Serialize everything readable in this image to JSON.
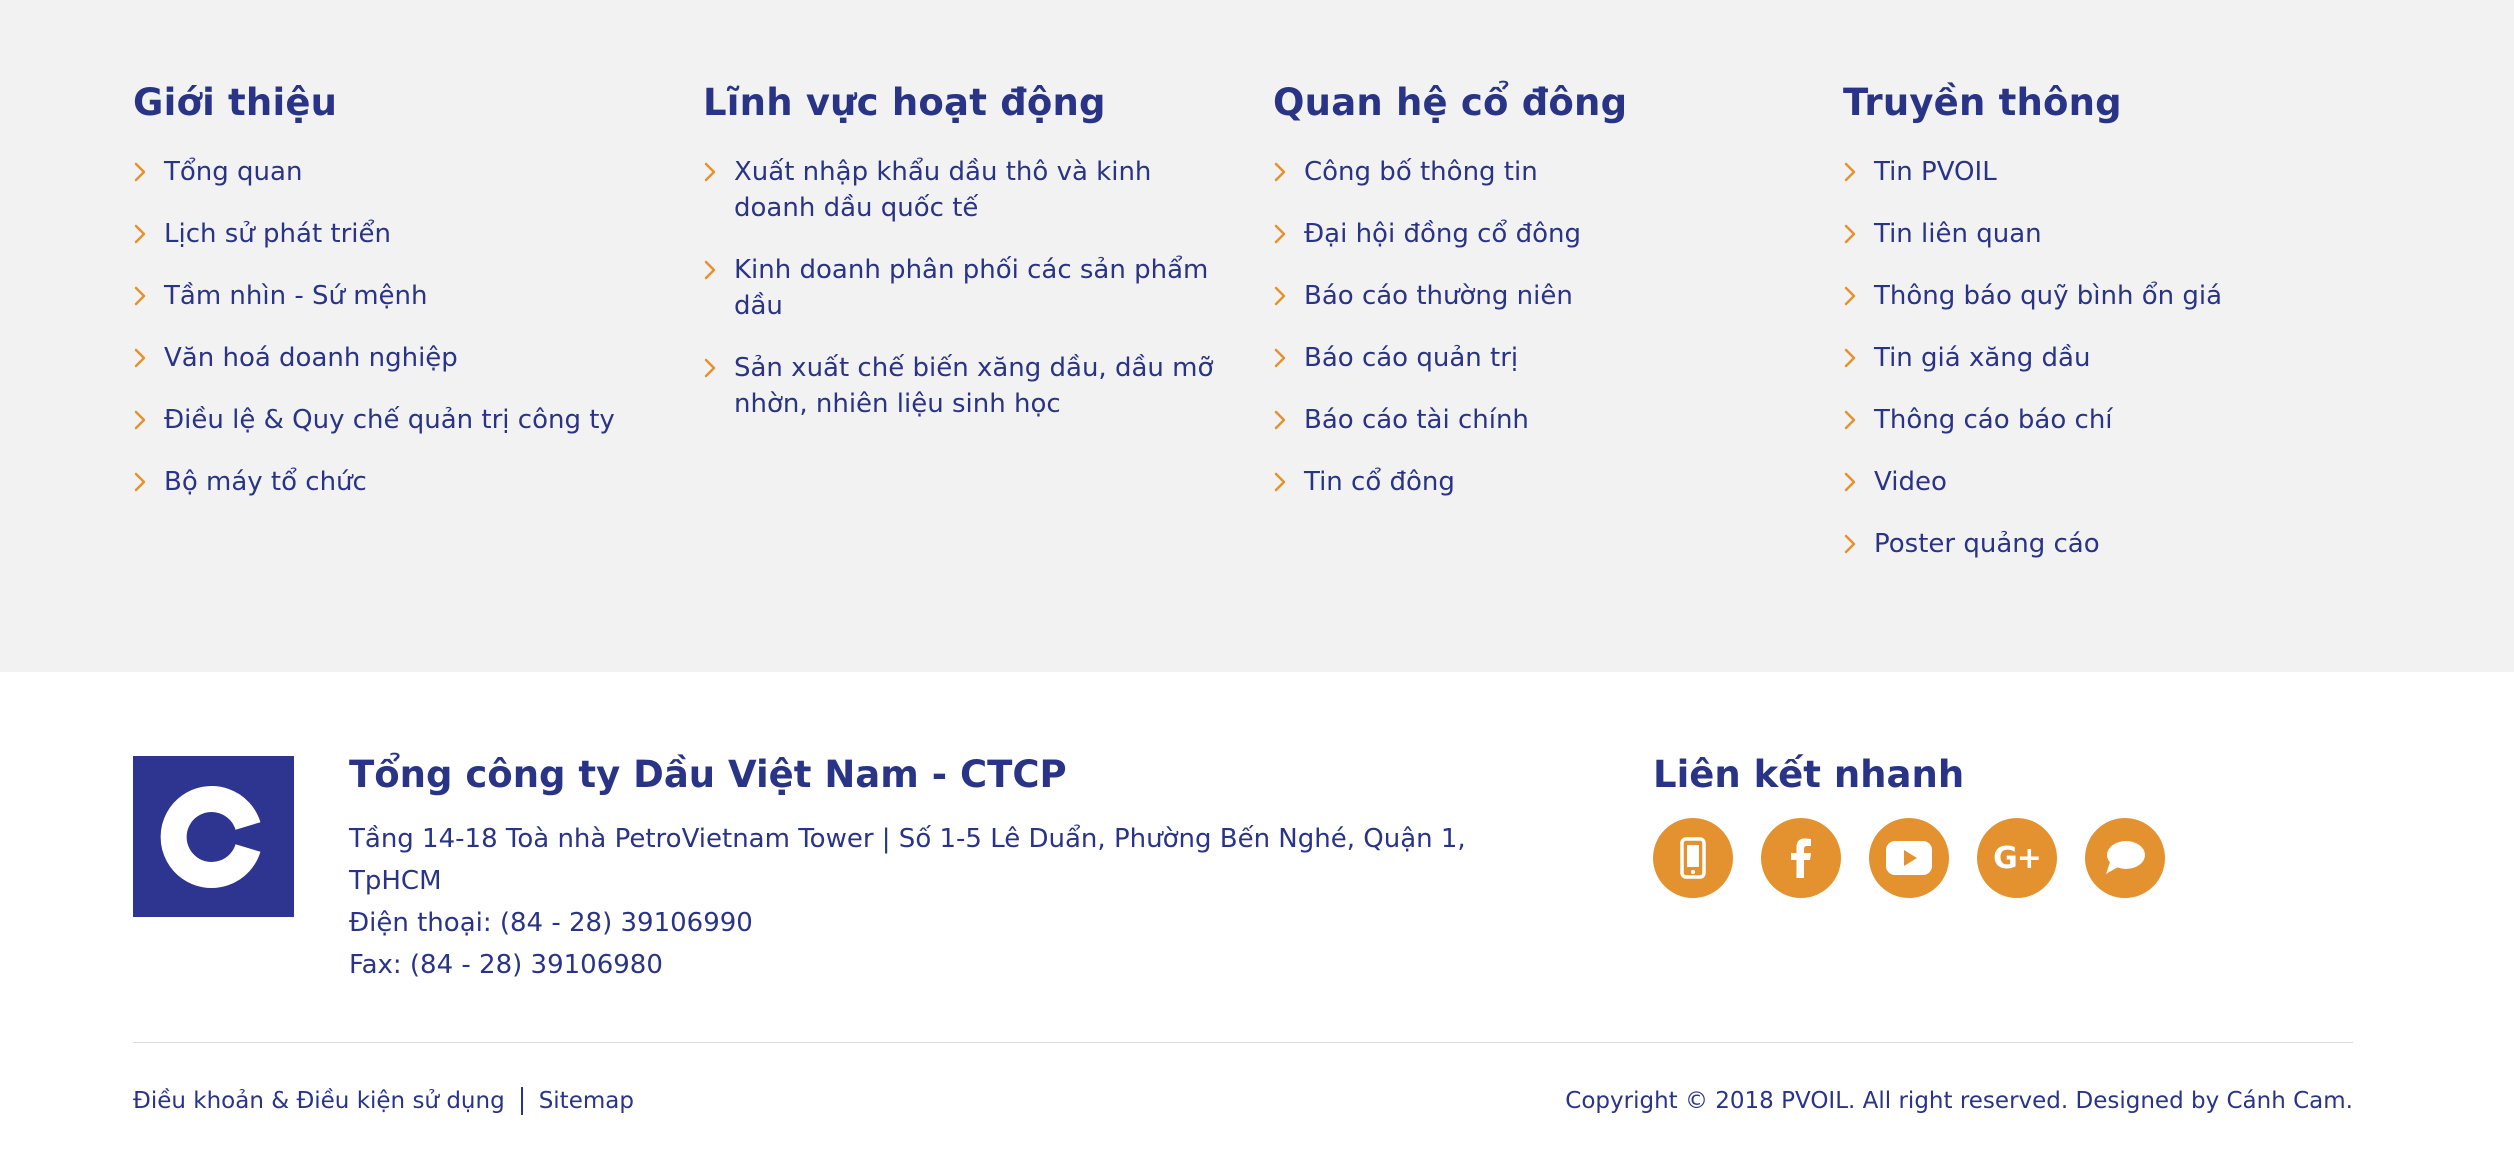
{
  "columns": [
    {
      "title": "Giới thiệu",
      "items": [
        "Tổng quan",
        "Lịch sử phát triển",
        "Tầm nhìn - Sứ mệnh",
        "Văn hoá doanh nghiệp",
        "Điều lệ & Quy chế quản trị công ty",
        "Bộ máy tổ chức"
      ]
    },
    {
      "title": "Lĩnh vực hoạt động",
      "items": [
        "Xuất nhập khẩu dầu thô và kinh doanh dầu quốc tế",
        "Kinh doanh phân phối các sản phẩm dầu",
        "Sản xuất chế biến xăng dầu, dầu mỡ nhờn, nhiên liệu sinh học"
      ]
    },
    {
      "title": "Quan hệ cổ đông",
      "items": [
        "Công bố thông tin",
        "Đại hội đồng cổ đông",
        "Báo cáo thường niên",
        "Báo cáo quản trị",
        "Báo cáo tài chính",
        "Tin cổ đông"
      ]
    },
    {
      "title": "Truyền thông",
      "items": [
        "Tin PVOIL",
        "Tin liên quan",
        "Thông báo quỹ bình ổn giá",
        "Tin giá xăng dầu",
        "Thông cáo báo chí",
        "Video",
        "Poster quảng cáo"
      ]
    }
  ],
  "company": {
    "name": "Tổng công ty Dầu Việt Nam - CTCP",
    "address": "Tầng 14-18 Toà nhà PetroVietnam Tower | Số 1-5 Lê Duẩn, Phường Bến Nghé, Quận 1, TpHCM",
    "phone": "Điện thoại: (84 - 28) 39106990",
    "fax": "Fax: (84 - 28) 39106980",
    "logo_icon": "c-logo-icon"
  },
  "quick_links": {
    "title": "Liên kết nhanh",
    "icons": [
      "phone-icon",
      "facebook-icon",
      "youtube-icon",
      "google-plus-icon",
      "chat-icon"
    ],
    "google_plus_glyph": "G+"
  },
  "footer": {
    "terms": "Điều khoản & Điều kiện sử dụng",
    "sitemap": "Sitemap",
    "copyright": "Copyright © 2018 PVOIL. All right reserved. Designed by Cánh Cam."
  },
  "colors": {
    "primary": "#2a3486",
    "accent": "#e3922f",
    "top_background": "#f2f2f2"
  }
}
